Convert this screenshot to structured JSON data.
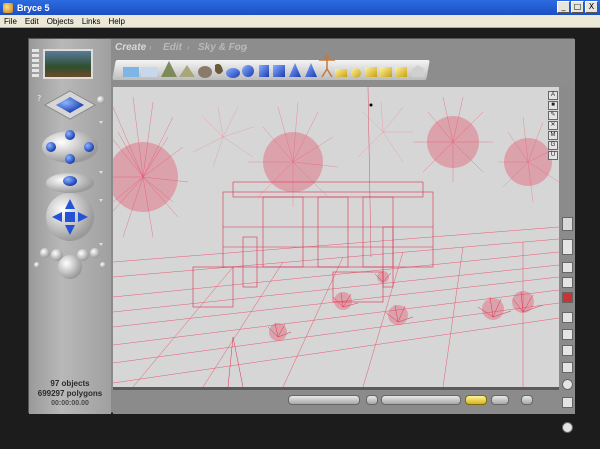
{
  "window": {
    "title": "Bryce 5",
    "controls": [
      "_",
      "□",
      "X"
    ]
  },
  "menu": [
    "File",
    "Edit",
    "Objects",
    "Links",
    "Help"
  ],
  "palettes": {
    "tabs": [
      {
        "label": "Create",
        "active": true
      },
      {
        "label": "Edit",
        "active": false
      },
      {
        "label": "Sky & Fog",
        "active": false
      }
    ]
  },
  "view_controls": {
    "letters": [
      "A",
      "■",
      "✎",
      "✕",
      "M",
      "G",
      "U"
    ]
  },
  "status": {
    "objects": "97 objects",
    "polygons": "699297 polygons",
    "time": "00:00:00.00"
  },
  "colors": {
    "wire": "#e8435f",
    "wire_light": "#f07a91",
    "viewport_bg": "#d4d4d4",
    "chrome": "#8b8b8b"
  }
}
